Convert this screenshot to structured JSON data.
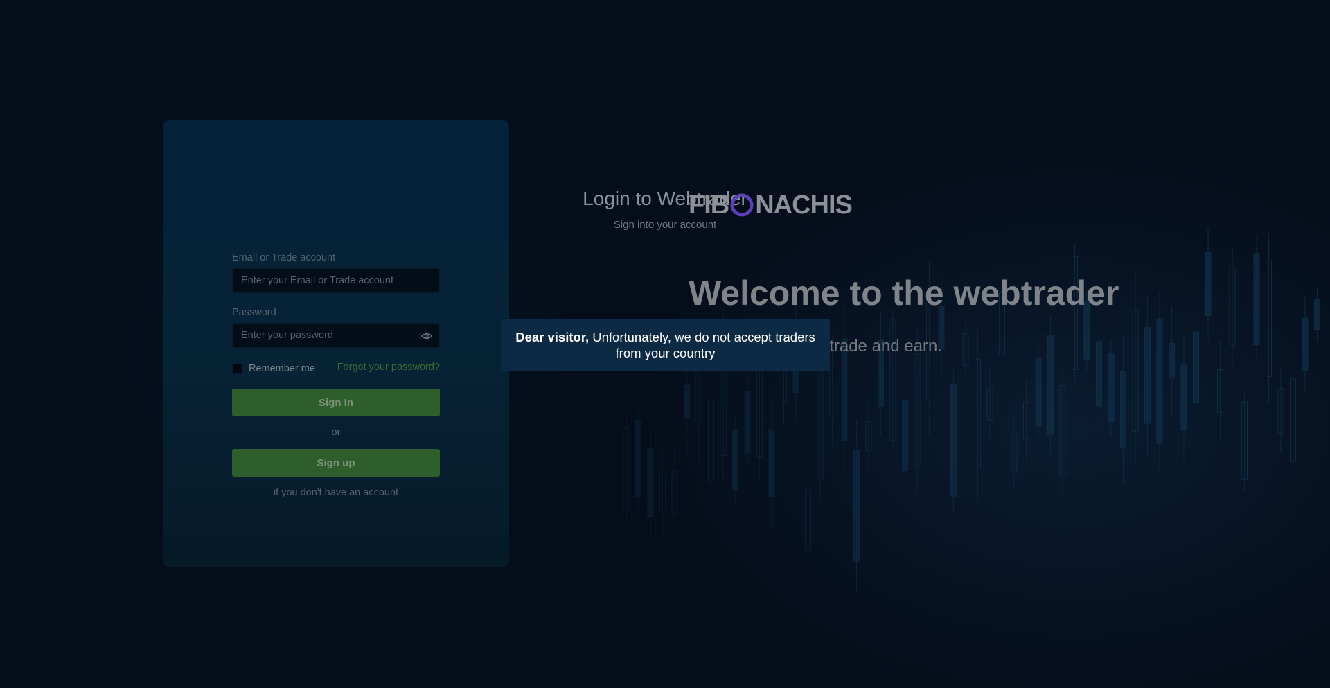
{
  "login": {
    "title": "Login to Webtrader",
    "subtitle": "Sign into your account",
    "email_label": "Email or Trade account",
    "email_placeholder": "Enter your Email or Trade account",
    "email_value": "",
    "password_label": "Password",
    "password_placeholder": "Enter your password",
    "password_value": "",
    "remember_label": "Remember me",
    "remember_checked": false,
    "forgot_label": "Forgot your password?",
    "signin_label": "Sign In",
    "or_label": "or",
    "signup_label": "Sign up",
    "no_account_label": "if you don't have an account"
  },
  "brand": {
    "logo_part1": "FIB",
    "logo_part2": "NACHIS",
    "logo_ring_color": "#5b3fb8",
    "welcome": "Welcome to the webtrader",
    "tagline": "trade and earn."
  },
  "modal": {
    "bold_text": "Dear visitor,",
    "message": "Unfortunately, we do not accept traders from your country"
  },
  "colors": {
    "background": "#050d1a",
    "card": "#04233a",
    "button": "#2e5e2c",
    "modal": "#0c2a44",
    "link": "#3c6a33"
  }
}
